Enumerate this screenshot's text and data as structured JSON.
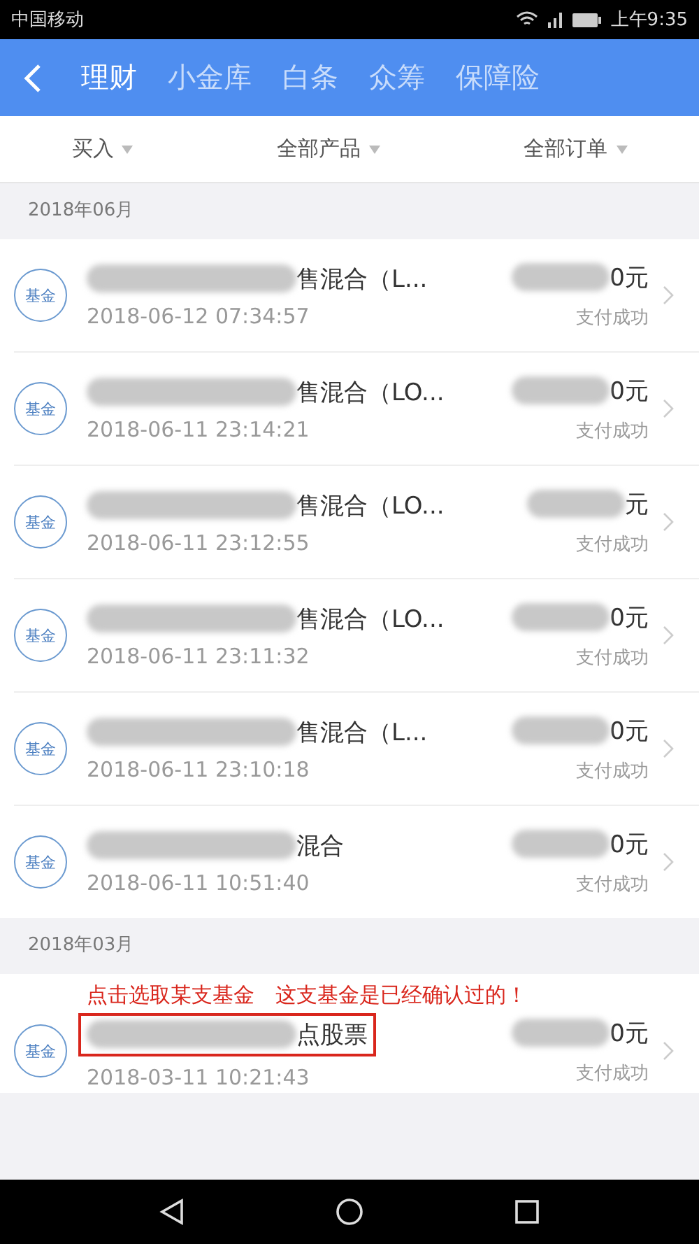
{
  "status_bar": {
    "carrier": "中国移动",
    "time": "上午9:35"
  },
  "tabs": [
    {
      "label": "理财",
      "selected": true
    },
    {
      "label": "小金库",
      "selected": false
    },
    {
      "label": "白条",
      "selected": false
    },
    {
      "label": "众筹",
      "selected": false
    },
    {
      "label": "保障险",
      "selected": false
    }
  ],
  "filters": [
    "买入",
    "全部产品",
    "全部订单"
  ],
  "sections": [
    {
      "month": "2018年06月",
      "orders": [
        {
          "badge": "基金",
          "name": "售混合（L...",
          "redacted": true,
          "amount": "0元",
          "time": "2018-06-12 07:34:57",
          "status": "支付成功"
        },
        {
          "badge": "基金",
          "name": "售混合（LO...",
          "redacted": true,
          "amount": "0元",
          "time": "2018-06-11 23:14:21",
          "status": "支付成功"
        },
        {
          "badge": "基金",
          "name": "售混合（LO...",
          "redacted": true,
          "amount": "元",
          "time": "2018-06-11 23:12:55",
          "status": "支付成功"
        },
        {
          "badge": "基金",
          "name": "售混合（LO...",
          "redacted": true,
          "amount": "0元",
          "time": "2018-06-11 23:11:32",
          "status": "支付成功"
        },
        {
          "badge": "基金",
          "name": "售混合（L...",
          "redacted": true,
          "amount": "0元",
          "time": "2018-06-11 23:10:18",
          "status": "支付成功"
        },
        {
          "badge": "基金",
          "name": "混合",
          "redacted": true,
          "amount": "0元",
          "time": "2018-06-11 10:51:40",
          "status": "支付成功"
        }
      ]
    },
    {
      "month": "2018年03月",
      "orders": [
        {
          "badge": "基金",
          "name": "点股票",
          "redacted": true,
          "amount": "0元",
          "time": "2018-03-11 10:21:43",
          "status": "支付成功",
          "annotation": "点击选取某支基金　这支基金是已经确认过的！"
        }
      ]
    }
  ]
}
